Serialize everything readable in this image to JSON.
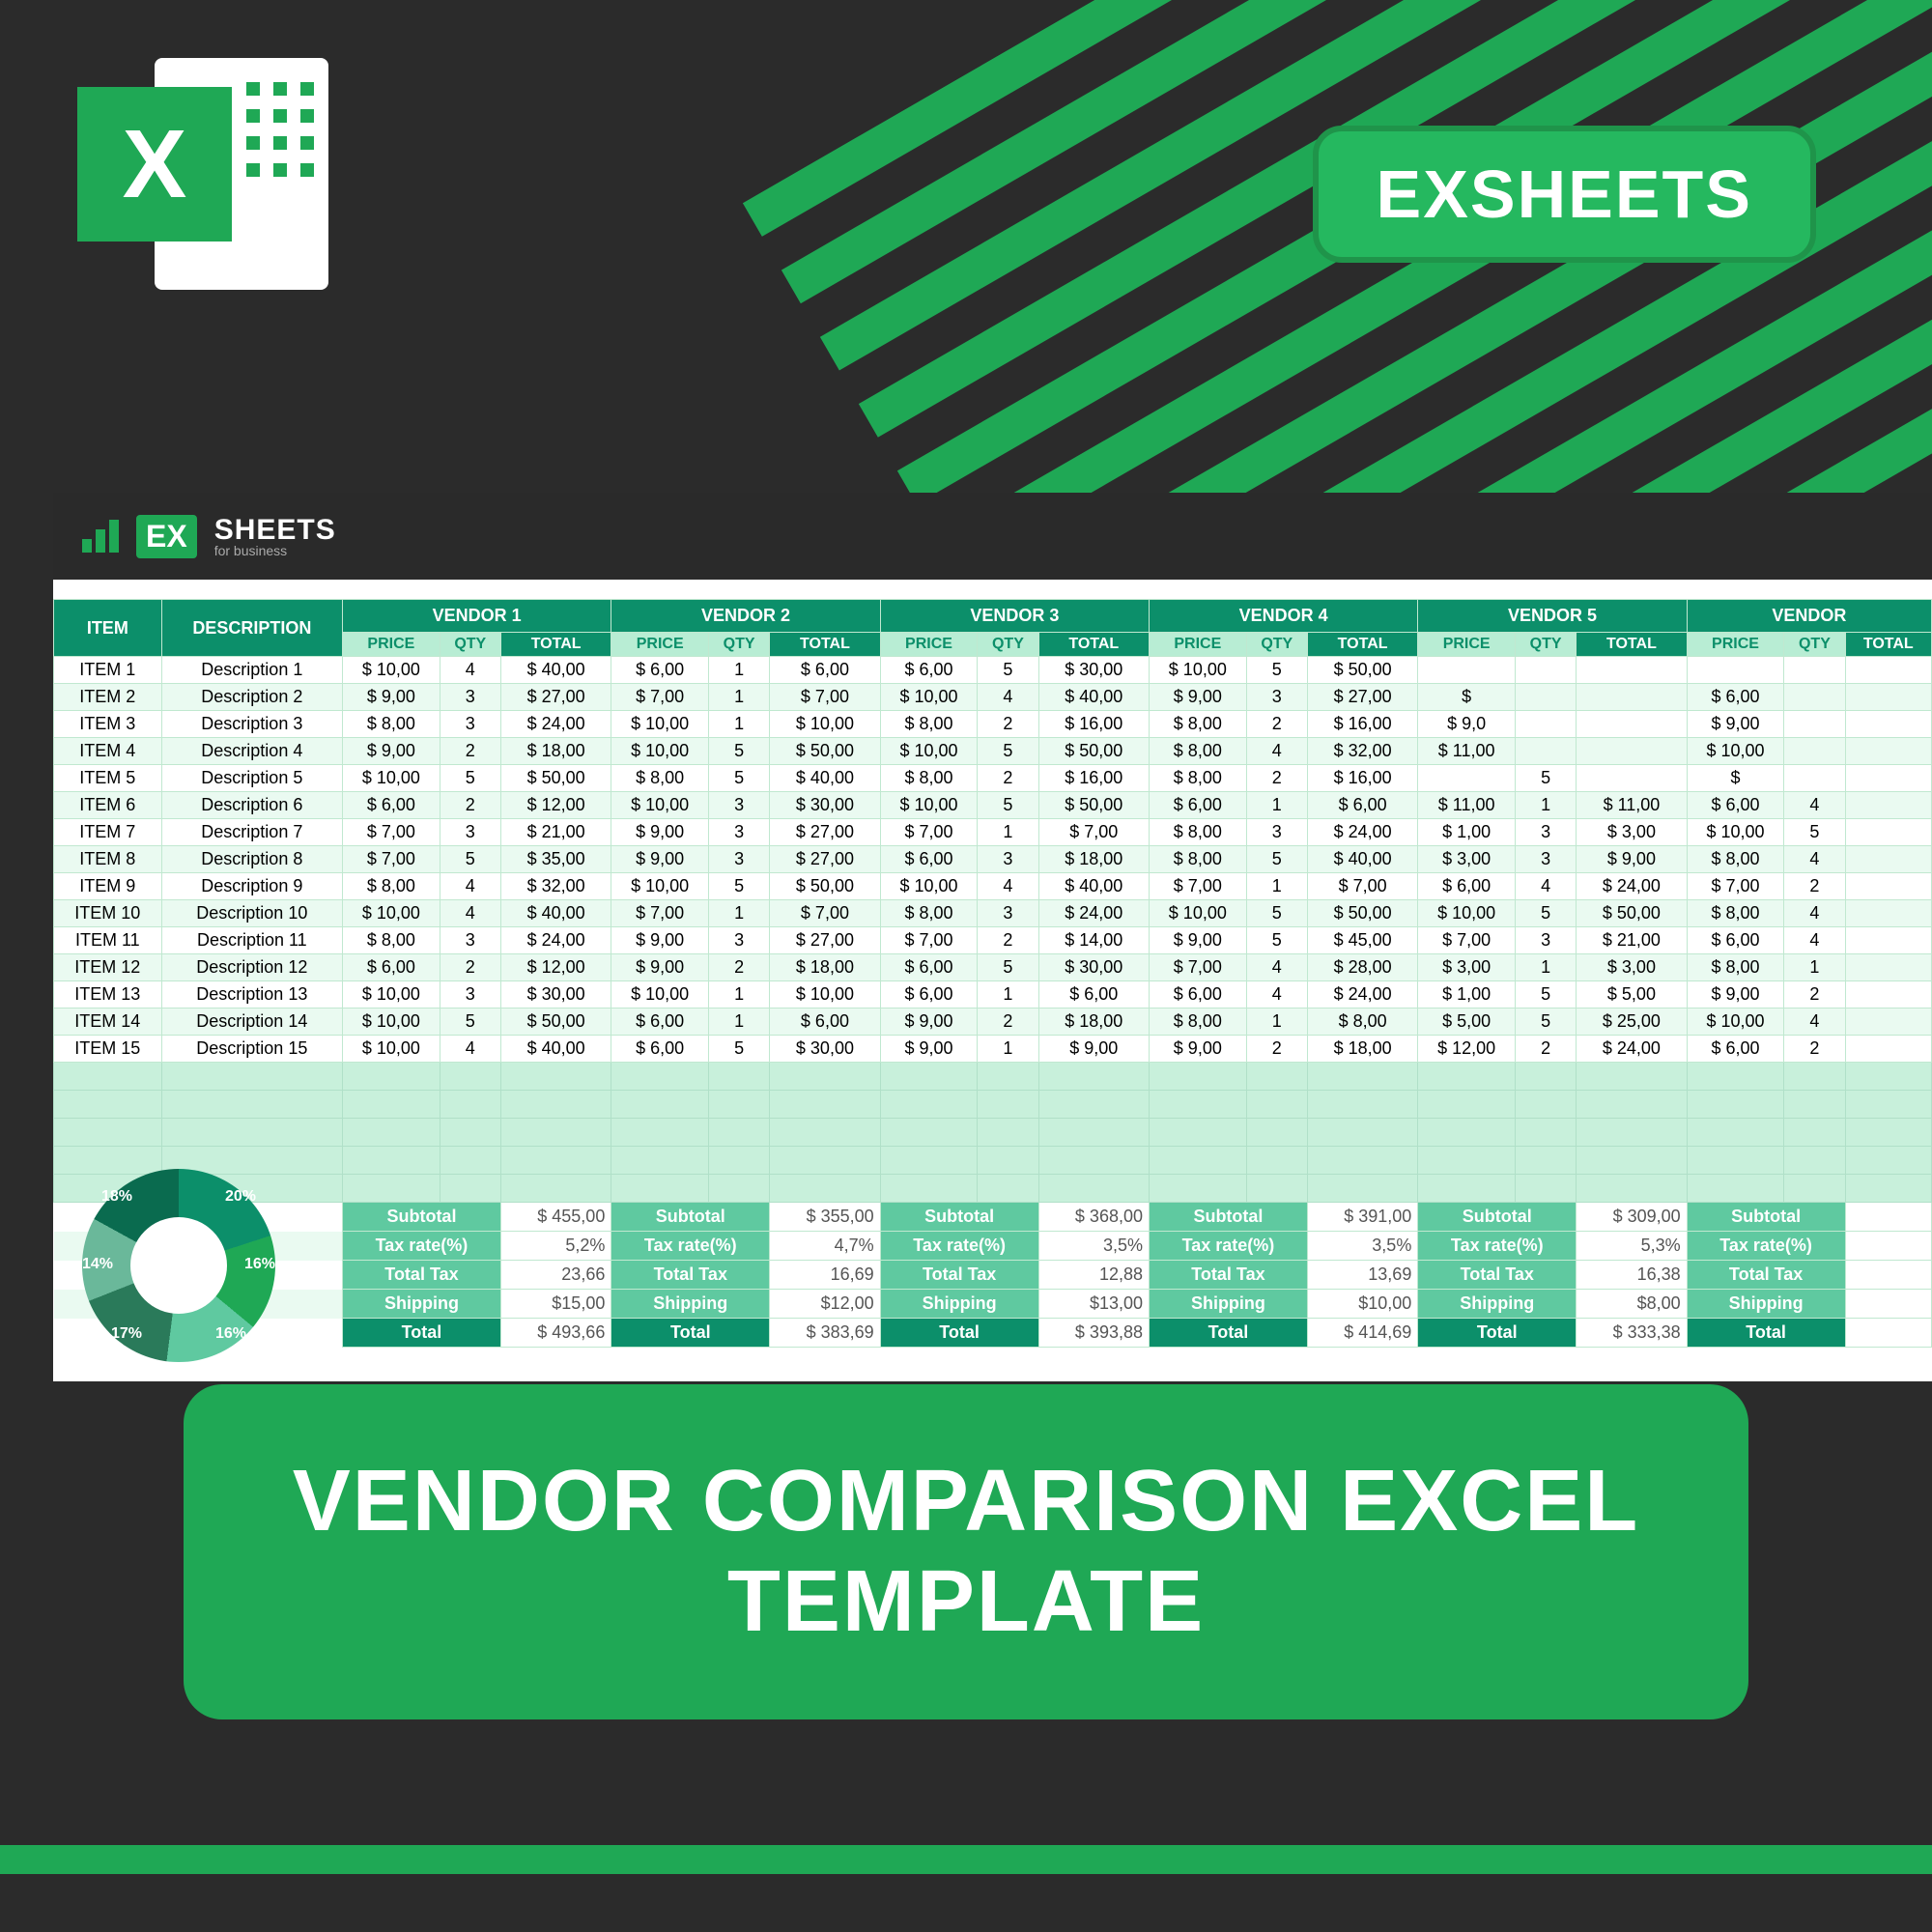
{
  "badge": "EXSHEETS",
  "sheetBrand": {
    "ex": "EX",
    "main": "SHEETS",
    "sub": "for business"
  },
  "title": "VENDOR COMPARISON EXCEL TEMPLATE",
  "headers": {
    "item": "ITEM",
    "desc": "DESCRIPTION",
    "price": "PRICE",
    "qty": "QTY",
    "total": "TOTAL"
  },
  "vendors": [
    "VENDOR 1",
    "VENDOR 2",
    "VENDOR 3",
    "VENDOR 4",
    "VENDOR 5",
    "VENDOR"
  ],
  "rows": [
    {
      "item": "ITEM 1",
      "desc": "Description 1",
      "v": [
        [
          "$ 10,00",
          "4",
          "$ 40,00"
        ],
        [
          "$ 6,00",
          "1",
          "$ 6,00"
        ],
        [
          "$ 6,00",
          "5",
          "$ 30,00"
        ],
        [
          "$ 10,00",
          "5",
          "$ 50,00"
        ],
        [
          "",
          "",
          ""
        ],
        [
          "",
          "",
          ""
        ]
      ]
    },
    {
      "item": "ITEM 2",
      "desc": "Description 2",
      "v": [
        [
          "$ 9,00",
          "3",
          "$ 27,00"
        ],
        [
          "$ 7,00",
          "1",
          "$ 7,00"
        ],
        [
          "$ 10,00",
          "4",
          "$ 40,00"
        ],
        [
          "$ 9,00",
          "3",
          "$ 27,00"
        ],
        [
          "$",
          "",
          ""
        ],
        [
          "$ 6,00",
          "",
          ""
        ]
      ]
    },
    {
      "item": "ITEM 3",
      "desc": "Description 3",
      "v": [
        [
          "$ 8,00",
          "3",
          "$ 24,00"
        ],
        [
          "$ 10,00",
          "1",
          "$ 10,00"
        ],
        [
          "$ 8,00",
          "2",
          "$ 16,00"
        ],
        [
          "$ 8,00",
          "2",
          "$ 16,00"
        ],
        [
          "$ 9,0",
          "",
          ""
        ],
        [
          "$ 9,00",
          "",
          ""
        ]
      ]
    },
    {
      "item": "ITEM 4",
      "desc": "Description 4",
      "v": [
        [
          "$ 9,00",
          "2",
          "$ 18,00"
        ],
        [
          "$ 10,00",
          "5",
          "$ 50,00"
        ],
        [
          "$ 10,00",
          "5",
          "$ 50,00"
        ],
        [
          "$ 8,00",
          "4",
          "$ 32,00"
        ],
        [
          "$ 11,00",
          "",
          ""
        ],
        [
          "$ 10,00",
          "",
          ""
        ]
      ]
    },
    {
      "item": "ITEM 5",
      "desc": "Description 5",
      "v": [
        [
          "$ 10,00",
          "5",
          "$ 50,00"
        ],
        [
          "$ 8,00",
          "5",
          "$ 40,00"
        ],
        [
          "$ 8,00",
          "2",
          "$ 16,00"
        ],
        [
          "$ 8,00",
          "2",
          "$ 16,00"
        ],
        [
          "",
          "5",
          ""
        ],
        [
          "$",
          "",
          ""
        ]
      ]
    },
    {
      "item": "ITEM 6",
      "desc": "Description 6",
      "v": [
        [
          "$ 6,00",
          "2",
          "$ 12,00"
        ],
        [
          "$ 10,00",
          "3",
          "$ 30,00"
        ],
        [
          "$ 10,00",
          "5",
          "$ 50,00"
        ],
        [
          "$ 6,00",
          "1",
          "$ 6,00"
        ],
        [
          "$ 11,00",
          "1",
          "$ 11,00"
        ],
        [
          "$ 6,00",
          "4",
          ""
        ]
      ]
    },
    {
      "item": "ITEM 7",
      "desc": "Description 7",
      "v": [
        [
          "$ 7,00",
          "3",
          "$ 21,00"
        ],
        [
          "$ 9,00",
          "3",
          "$ 27,00"
        ],
        [
          "$ 7,00",
          "1",
          "$ 7,00"
        ],
        [
          "$ 8,00",
          "3",
          "$ 24,00"
        ],
        [
          "$ 1,00",
          "3",
          "$ 3,00"
        ],
        [
          "$ 10,00",
          "5",
          ""
        ]
      ]
    },
    {
      "item": "ITEM 8",
      "desc": "Description 8",
      "v": [
        [
          "$ 7,00",
          "5",
          "$ 35,00"
        ],
        [
          "$ 9,00",
          "3",
          "$ 27,00"
        ],
        [
          "$ 6,00",
          "3",
          "$ 18,00"
        ],
        [
          "$ 8,00",
          "5",
          "$ 40,00"
        ],
        [
          "$ 3,00",
          "3",
          "$ 9,00"
        ],
        [
          "$ 8,00",
          "4",
          ""
        ]
      ]
    },
    {
      "item": "ITEM 9",
      "desc": "Description 9",
      "v": [
        [
          "$ 8,00",
          "4",
          "$ 32,00"
        ],
        [
          "$ 10,00",
          "5",
          "$ 50,00"
        ],
        [
          "$ 10,00",
          "4",
          "$ 40,00"
        ],
        [
          "$ 7,00",
          "1",
          "$ 7,00"
        ],
        [
          "$ 6,00",
          "4",
          "$ 24,00"
        ],
        [
          "$ 7,00",
          "2",
          ""
        ]
      ]
    },
    {
      "item": "ITEM 10",
      "desc": "Description 10",
      "v": [
        [
          "$ 10,00",
          "4",
          "$ 40,00"
        ],
        [
          "$ 7,00",
          "1",
          "$ 7,00"
        ],
        [
          "$ 8,00",
          "3",
          "$ 24,00"
        ],
        [
          "$ 10,00",
          "5",
          "$ 50,00"
        ],
        [
          "$ 10,00",
          "5",
          "$ 50,00"
        ],
        [
          "$ 8,00",
          "4",
          ""
        ]
      ]
    },
    {
      "item": "ITEM 11",
      "desc": "Description 11",
      "v": [
        [
          "$ 8,00",
          "3",
          "$ 24,00"
        ],
        [
          "$ 9,00",
          "3",
          "$ 27,00"
        ],
        [
          "$ 7,00",
          "2",
          "$ 14,00"
        ],
        [
          "$ 9,00",
          "5",
          "$ 45,00"
        ],
        [
          "$ 7,00",
          "3",
          "$ 21,00"
        ],
        [
          "$ 6,00",
          "4",
          ""
        ]
      ]
    },
    {
      "item": "ITEM 12",
      "desc": "Description 12",
      "v": [
        [
          "$ 6,00",
          "2",
          "$ 12,00"
        ],
        [
          "$ 9,00",
          "2",
          "$ 18,00"
        ],
        [
          "$ 6,00",
          "5",
          "$ 30,00"
        ],
        [
          "$ 7,00",
          "4",
          "$ 28,00"
        ],
        [
          "$ 3,00",
          "1",
          "$ 3,00"
        ],
        [
          "$ 8,00",
          "1",
          ""
        ]
      ]
    },
    {
      "item": "ITEM 13",
      "desc": "Description 13",
      "v": [
        [
          "$ 10,00",
          "3",
          "$ 30,00"
        ],
        [
          "$ 10,00",
          "1",
          "$ 10,00"
        ],
        [
          "$ 6,00",
          "1",
          "$ 6,00"
        ],
        [
          "$ 6,00",
          "4",
          "$ 24,00"
        ],
        [
          "$ 1,00",
          "5",
          "$ 5,00"
        ],
        [
          "$ 9,00",
          "2",
          ""
        ]
      ]
    },
    {
      "item": "ITEM 14",
      "desc": "Description 14",
      "v": [
        [
          "$ 10,00",
          "5",
          "$ 50,00"
        ],
        [
          "$ 6,00",
          "1",
          "$ 6,00"
        ],
        [
          "$ 9,00",
          "2",
          "$ 18,00"
        ],
        [
          "$ 8,00",
          "1",
          "$ 8,00"
        ],
        [
          "$ 5,00",
          "5",
          "$ 25,00"
        ],
        [
          "$ 10,00",
          "4",
          ""
        ]
      ]
    },
    {
      "item": "ITEM 15",
      "desc": "Description 15",
      "v": [
        [
          "$ 10,00",
          "4",
          "$ 40,00"
        ],
        [
          "$ 6,00",
          "5",
          "$ 30,00"
        ],
        [
          "$ 9,00",
          "1",
          "$ 9,00"
        ],
        [
          "$ 9,00",
          "2",
          "$ 18,00"
        ],
        [
          "$ 12,00",
          "2",
          "$ 24,00"
        ],
        [
          "$ 6,00",
          "2",
          ""
        ]
      ]
    }
  ],
  "summary": {
    "labels": [
      "Subtotal",
      "Tax rate(%)",
      "Total Tax",
      "Shipping",
      "Total"
    ],
    "vendors": [
      {
        "subtotal": "$ 455,00",
        "tax": "5,2%",
        "totalTax": "23,66",
        "ship": "$15,00",
        "total": "$ 493,66"
      },
      {
        "subtotal": "$ 355,00",
        "tax": "4,7%",
        "totalTax": "16,69",
        "ship": "$12,00",
        "total": "$ 383,69"
      },
      {
        "subtotal": "$ 368,00",
        "tax": "3,5%",
        "totalTax": "12,88",
        "ship": "$13,00",
        "total": "$ 393,88"
      },
      {
        "subtotal": "$ 391,00",
        "tax": "3,5%",
        "totalTax": "13,69",
        "ship": "$10,00",
        "total": "$ 414,69"
      },
      {
        "subtotal": "$ 309,00",
        "tax": "5,3%",
        "totalTax": "16,38",
        "ship": "$8,00",
        "total": "$ 333,38"
      },
      {
        "subtotal": "",
        "tax": "",
        "totalTax": "",
        "ship": "",
        "total": ""
      }
    ]
  },
  "donut": [
    "18%",
    "20%",
    "16%",
    "16%",
    "17%",
    "14%"
  ]
}
